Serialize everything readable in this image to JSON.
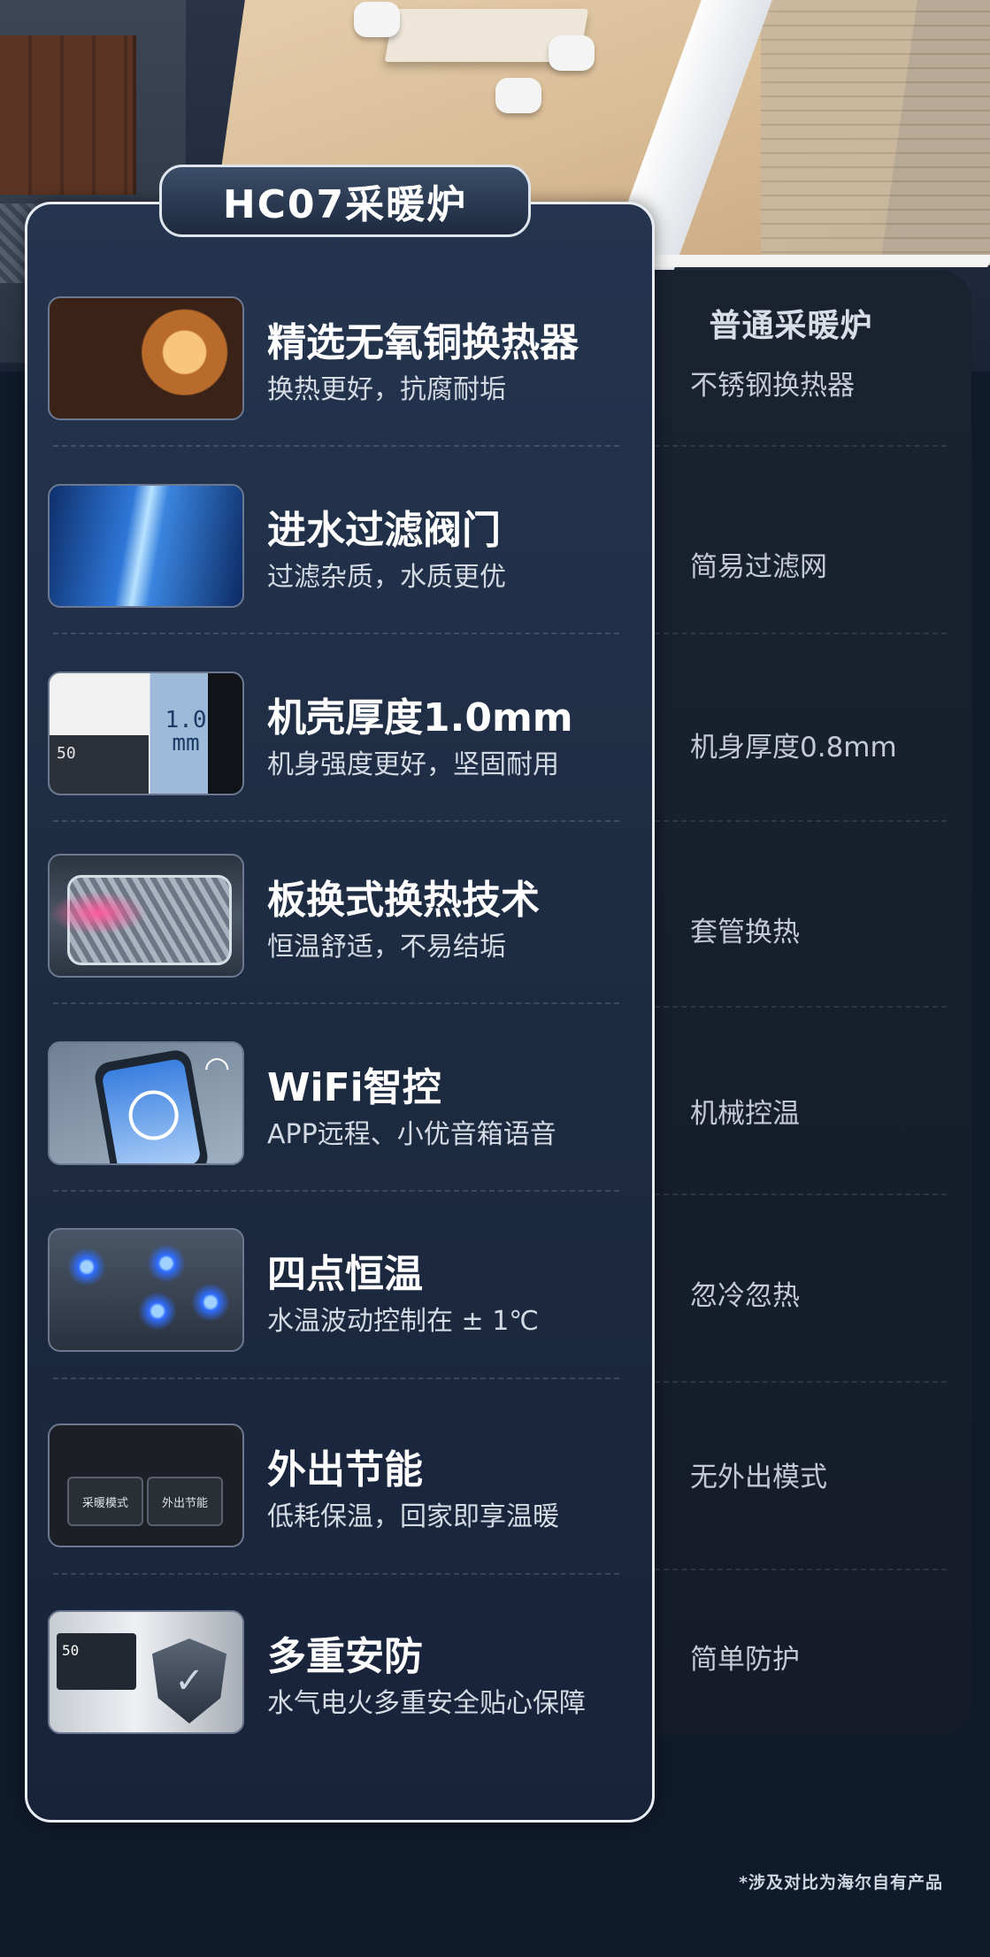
{
  "title": "HC07采暖炉",
  "competitor_title": "普通采暖炉",
  "features": [
    {
      "title": "精选无氧铜换热器",
      "subtitle": "换热更好，抗腐耐垢",
      "competitor": "不锈钢换热器",
      "icon": "copper-heat-exchanger-icon"
    },
    {
      "title": "进水过滤阀门",
      "subtitle": "过滤杂质，水质更优",
      "competitor": "简易过滤网",
      "icon": "water-filter-valve-icon"
    },
    {
      "title": "机壳厚度1.0mm",
      "subtitle": "机身强度更好，坚固耐用",
      "competitor": "机身厚度0.8mm",
      "icon": "casing-thickness-icon"
    },
    {
      "title": "板换式换热技术",
      "subtitle": "恒温舒适，不易结垢",
      "competitor": "套管换热",
      "icon": "plate-heat-exchanger-icon"
    },
    {
      "title": "WiFi智控",
      "subtitle": "APP远程、小优音箱语音",
      "competitor": "机械控温",
      "icon": "wifi-phone-icon"
    },
    {
      "title": "四点恒温",
      "subtitle": "水温波动控制在 ± 1℃",
      "competitor": "忽冷忽热",
      "icon": "four-point-flame-icon"
    },
    {
      "title": "外出节能",
      "subtitle": "低耗保温，回家即享温暖",
      "competitor": "无外出模式",
      "icon": "away-mode-panel-icon"
    },
    {
      "title": "多重安防",
      "subtitle": "水气电火多重安全贴心保障",
      "competitor": "简单防护",
      "icon": "safety-shield-icon"
    }
  ],
  "thumbnails": {
    "case_digits": "50",
    "case_label": "1.0 mm",
    "panel_buttons": [
      "采暖模式",
      "外出节能"
    ],
    "safe_digits": "50"
  },
  "footnote": "*涉及对比为海尔自有产品",
  "colors": {
    "background": "#0f1a2b",
    "panel_border": "#e9edf3",
    "text": "#ffffff"
  }
}
